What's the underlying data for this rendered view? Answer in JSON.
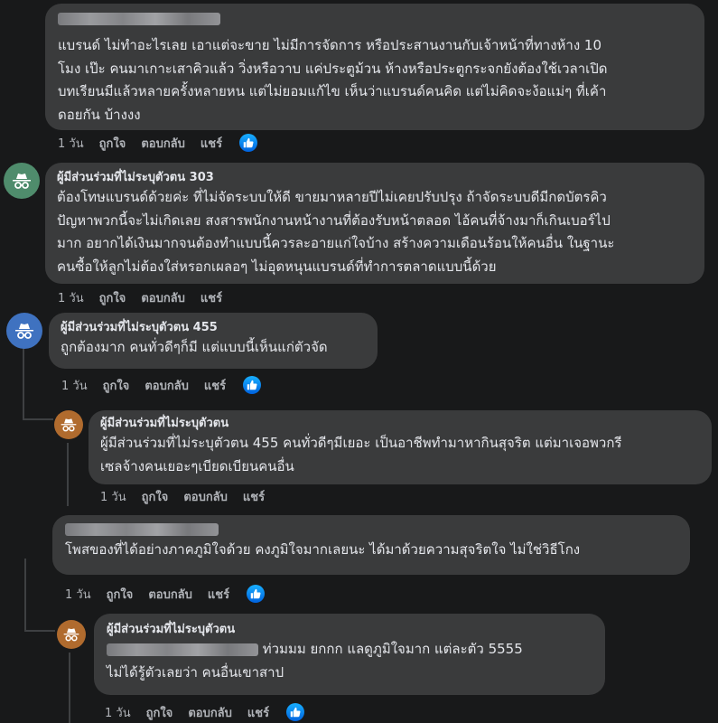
{
  "actions": {
    "time": "1 วัน",
    "like": "ถูกใจ",
    "reply": "ตอบกลับ",
    "share": "แชร์"
  },
  "comments": [
    {
      "author": "",
      "lines": [
        "แบรนด์ ไม่ทำอะไรเลย เอาแต่จะขาย ไม่มีการจัดการ หรือประสานงานกับเจ้าหน้าที่ทางห้าง 10",
        "โมง เป๊ะ คนมาเกาะเสาคิวแล้ว วิ่งหรือวาบ แค่ประตูม้วน ห้างหรือประตูกระจกยังต้องใช้เวลาเปิด",
        "บทเรียนมีแล้วหลายครั้งหลายหน แต่ไม่ยอมแก้ไข เห็นว่าแบรนด์คนคิด แต่ไม่คิดจะง้อแม่ๆ ที่เค้า",
        "ดอยกัน บ้างงง"
      ]
    },
    {
      "author": "ผู้มีส่วนร่วมที่ไม่ระบุตัวตน 303",
      "lines": [
        "ต้องโทษแบรนด์ด้วยค่ะ ที่ไม่จัดระบบให้ดี ขายมาหลายปีไม่เคยปรับปรุง ถ้าจัดระบบดีมีกดบัตรคิว",
        "ปัญหาพวกนี้จะไม่เกิดเลย สงสารพนักงานหน้างานที่ต้องรับหน้าตลอด ไอ้คนที่จ้างมาก็เกินเบอร์ไป",
        "มาก อยากได้เงินมากจนต้องทำแบบนี้ควรละอายแก่ใจบ้าง สร้างความเดือนร้อนให้คนอื่น ในฐานะ",
        "คนซื้อให้ลูกไม่ต้องใส่หรอกเผลอๆ ไม่อุดหนุนแบรนด์ที่ทำการตลาดแบบนี้ด้วย"
      ]
    },
    {
      "author": "ผู้มีส่วนร่วมที่ไม่ระบุตัวตน 455",
      "lines": [
        "ถูกต้องมาก คนทั่วดีๆก็มี แต่แบบนี้เห็นแก่ตัวจัด"
      ]
    },
    {
      "author": "ผู้มีส่วนร่วมที่ไม่ระบุตัวตน",
      "lines": [
        "ผู้มีส่วนร่วมที่ไม่ระบุตัวตน 455 คนทั่วดีๆมีเยอะ เป็นอาชีพทำมาหากินสุจริต แต่มาเจอพวกรี",
        "เซลจ้างคนเยอะๆเบียดเบียนคนอื่น"
      ]
    },
    {
      "author": "",
      "lines": [
        "โพสของที่ได้อย่างภาคภูมิใจด้วย คงภูมิใจมากเลยนะ ได้มาด้วยความสุจริตใจ ไม่ใช่วิธีโกง"
      ]
    },
    {
      "author": "ผู้มีส่วนร่วมที่ไม่ระบุตัวตน",
      "lines": [
        "ท่วมมม ยกกก แลดูภูมิใจมาก แต่ละตัว 5555",
        "ไม่ได้รู้ตัวเลยว่า คนอื่นเขาสาป"
      ]
    }
  ],
  "colors": {
    "avatar_green": "#4f8c6c",
    "avatar_blue": "#3f72c0",
    "avatar_orange": "#b06b2e",
    "like_blue": "#1877f2"
  },
  "icons": {
    "avatar": "incognito-icon",
    "reaction": "thumbs-up-icon"
  }
}
